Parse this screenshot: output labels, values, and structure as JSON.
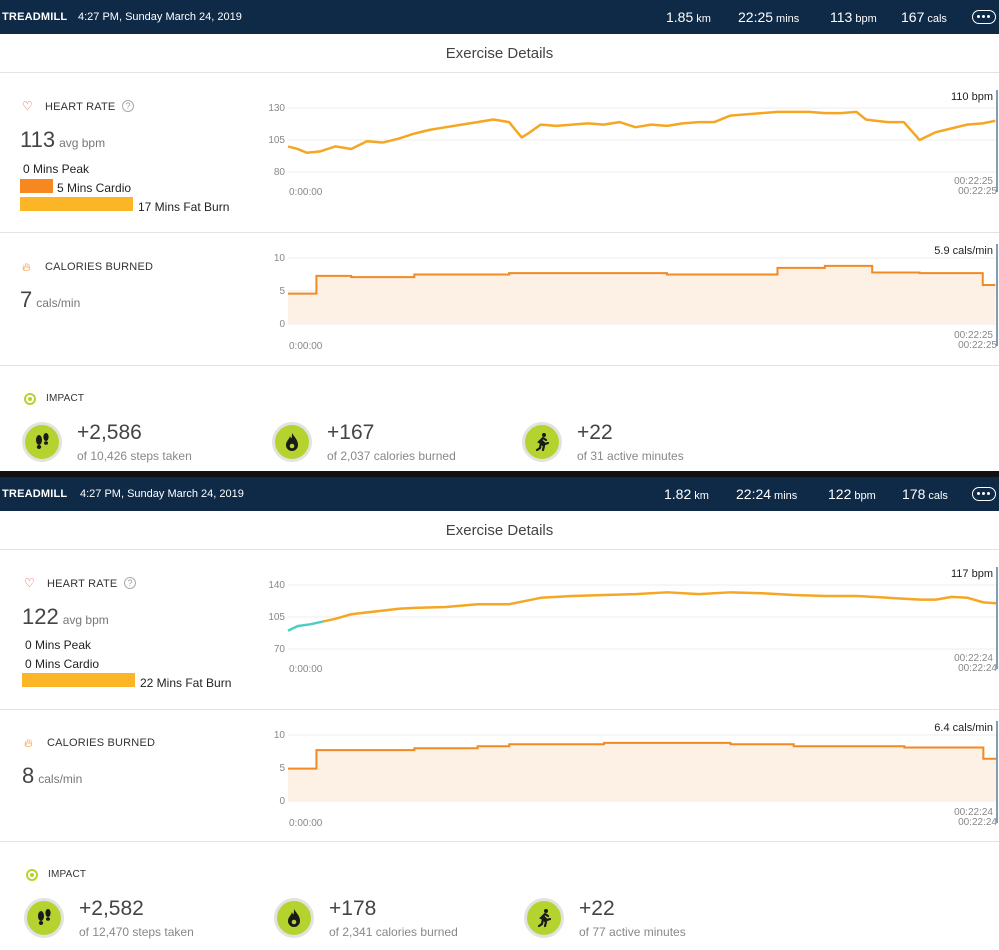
{
  "colors": {
    "header_bg": "#0e2a47",
    "hr_line": "#f5a623",
    "hr_line_low": "#4ecdc4",
    "cal_line": "#f08a24",
    "cal_fill": "#fdf1e6",
    "impact_green": "#b5d32f",
    "cardio": "#f7881f",
    "fat_burn": "#fbb527"
  },
  "icons": {
    "heart": "heart-outline-icon",
    "flame": "flame-icon",
    "impact": "target-ring-icon",
    "steps": "footprints-icon",
    "calories": "flame-icon",
    "active": "running-person-icon",
    "more": "ellipsis-icon",
    "help": "question-mark-icon"
  },
  "panels": [
    {
      "header": {
        "type": "TREADMILL",
        "datetime": "4:27 PM, Sunday March 24, 2019",
        "distance": "1.85",
        "distance_unit": "km",
        "duration": "22:25",
        "duration_unit": "mins",
        "bpm": "113",
        "bpm_unit": "bpm",
        "cals": "167",
        "cals_unit": "cals"
      },
      "title": "Exercise Details",
      "heart": {
        "label": "HEART RATE",
        "help": "?",
        "avg": "113",
        "avg_unit": "avg bpm",
        "zones": [
          {
            "text": "0 Mins Peak",
            "minutes": 0
          },
          {
            "text": "5 Mins Cardio",
            "minutes": 5
          },
          {
            "text": "17 Mins Fat Burn",
            "minutes": 17
          }
        ]
      },
      "calories": {
        "label": "CALORIES BURNED",
        "value": "7",
        "unit": "cals/min"
      },
      "impact": {
        "label": "IMPACT",
        "items": [
          {
            "value": "+2,586",
            "sub": "of 10,426 steps taken"
          },
          {
            "value": "+167",
            "sub": "of 2,037 calories burned"
          },
          {
            "value": "+22",
            "sub": "of 31 active minutes"
          }
        ]
      }
    },
    {
      "header": {
        "type": "TREADMILL",
        "datetime": "4:27 PM, Sunday March 24, 2019",
        "distance": "1.82",
        "distance_unit": "km",
        "duration": "22:24",
        "duration_unit": "mins",
        "bpm": "122",
        "bpm_unit": "bpm",
        "cals": "178",
        "cals_unit": "cals"
      },
      "title": "Exercise Details",
      "heart": {
        "label": "HEART RATE",
        "help": "?",
        "avg": "122",
        "avg_unit": "avg bpm",
        "zones": [
          {
            "text": "0 Mins Peak",
            "minutes": 0
          },
          {
            "text": "0 Mins Cardio",
            "minutes": 0
          },
          {
            "text": "22 Mins Fat Burn",
            "minutes": 22
          }
        ]
      },
      "calories": {
        "label": "CALORIES BURNED",
        "value": "8",
        "unit": "cals/min"
      },
      "impact": {
        "label": "IMPACT",
        "items": [
          {
            "value": "+2,582",
            "sub": "of 12,470 steps taken"
          },
          {
            "value": "+178",
            "sub": "of 2,341 calories burned"
          },
          {
            "value": "+22",
            "sub": "of 77 active minutes"
          }
        ]
      }
    }
  ],
  "chart_data": [
    {
      "type": "line",
      "panel": 1,
      "metric": "heart_rate",
      "x_start_label": "0:00:00",
      "x_end_label": "00:22:25",
      "x_end_label2": "00:22:25",
      "current_label": "110 bpm",
      "yticks": [
        130,
        105,
        80
      ],
      "ylim": [
        80,
        130
      ],
      "xlim": [
        0,
        22.42
      ],
      "x": [
        0,
        0.3,
        0.6,
        1.0,
        1.5,
        2.0,
        2.5,
        3.0,
        3.5,
        4.0,
        4.5,
        5.0,
        5.5,
        6.0,
        6.5,
        7.0,
        7.4,
        7.6,
        8.0,
        8.5,
        9.0,
        9.5,
        10.0,
        10.5,
        11.0,
        11.5,
        12.0,
        12.5,
        13.0,
        13.5,
        14.0,
        14.5,
        15.0,
        15.5,
        16.0,
        16.5,
        17.0,
        17.5,
        18.0,
        18.3,
        18.6,
        19.0,
        19.5,
        20.0,
        20.5,
        21.0,
        21.5,
        22.0,
        22.4
      ],
      "y": [
        100,
        98,
        95,
        96,
        100,
        98,
        104,
        103,
        106,
        110,
        113,
        115,
        117,
        119,
        121,
        119,
        107,
        110,
        117,
        116,
        117,
        118,
        117,
        119,
        115,
        117,
        116,
        118,
        119,
        119,
        124,
        125,
        126,
        127,
        127,
        127,
        126,
        126,
        127,
        121,
        120,
        119,
        119,
        105,
        111,
        114,
        117,
        118,
        120
      ],
      "x_lowzone_end": 0
    },
    {
      "type": "area",
      "panel": 1,
      "metric": "calories_per_min",
      "x_start_label": "0:00:00",
      "x_end_label": "00:22:25",
      "x_end_label2": "00:22:25",
      "current_label": "5.9 cals/min",
      "yticks": [
        10,
        5,
        0
      ],
      "ylim": [
        0,
        10
      ],
      "xlim": [
        0,
        22.42
      ],
      "x": [
        0,
        0.9,
        0.9,
        2.0,
        2.0,
        4.0,
        4.0,
        7.0,
        7.0,
        12.0,
        12.0,
        15.5,
        15.5,
        17.0,
        17.0,
        18.5,
        18.5,
        20.0,
        20.0,
        22.0,
        22.0,
        22.4
      ],
      "y": [
        4.6,
        4.6,
        7.3,
        7.3,
        7.1,
        7.1,
        7.5,
        7.5,
        7.7,
        7.7,
        7.5,
        7.5,
        8.5,
        8.5,
        8.8,
        8.8,
        7.8,
        7.8,
        7.7,
        7.7,
        5.9,
        5.9
      ]
    },
    {
      "type": "line",
      "panel": 2,
      "metric": "heart_rate",
      "x_start_label": "0:00:00",
      "x_end_label": "00:22:24",
      "x_end_label2": "00:22:24",
      "current_label": "117 bpm",
      "yticks": [
        140,
        105,
        70
      ],
      "ylim": [
        70,
        140
      ],
      "xlim": [
        0,
        22.4
      ],
      "x": [
        0,
        0.3,
        0.7,
        1.1,
        1.5,
        2.0,
        2.5,
        3.0,
        3.5,
        4.0,
        5.0,
        6.0,
        7.0,
        8.0,
        9.0,
        10.0,
        11.0,
        12.0,
        13.0,
        14.0,
        15.0,
        16.0,
        17.0,
        18.0,
        19.0,
        20.0,
        20.5,
        21.0,
        21.5,
        22.0,
        22.4
      ],
      "y": [
        90,
        95,
        97,
        100,
        103,
        108,
        110,
        112,
        114,
        115,
        116,
        119,
        119,
        126,
        128,
        129,
        130,
        132,
        130,
        132,
        131,
        129,
        128,
        128,
        126,
        124,
        124,
        127,
        126,
        121,
        120
      ],
      "x_lowzone_end": 1.1
    },
    {
      "type": "area",
      "panel": 2,
      "metric": "calories_per_min",
      "x_start_label": "0:00:00",
      "x_end_label": "00:22:24",
      "x_end_label2": "00:22:24",
      "current_label": "6.4 cals/min",
      "yticks": [
        10,
        5,
        0
      ],
      "ylim": [
        0,
        10
      ],
      "xlim": [
        0,
        22.4
      ],
      "x": [
        0,
        0.9,
        0.9,
        4.0,
        4.0,
        6.0,
        6.0,
        7.0,
        7.0,
        10.0,
        10.0,
        14.0,
        14.0,
        16.0,
        16.0,
        19.5,
        19.5,
        22.0,
        22.0,
        22.4
      ],
      "y": [
        4.9,
        4.9,
        7.7,
        7.7,
        8.0,
        8.0,
        8.3,
        8.3,
        8.6,
        8.6,
        8.8,
        8.8,
        8.6,
        8.6,
        8.3,
        8.3,
        8.1,
        8.1,
        6.4,
        6.4
      ]
    }
  ]
}
